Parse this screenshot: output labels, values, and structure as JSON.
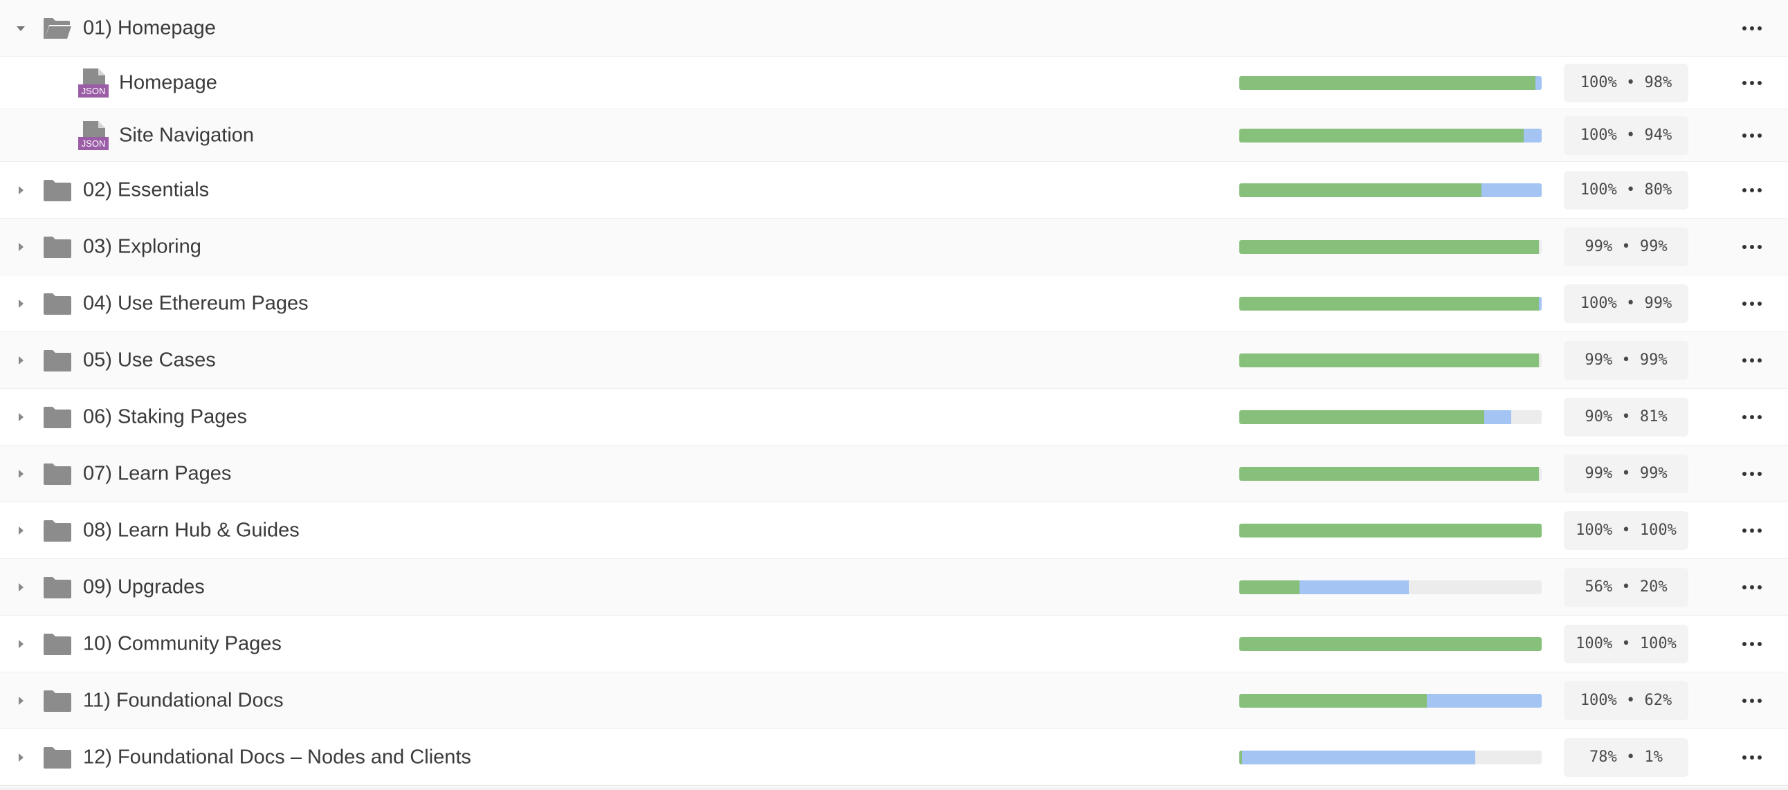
{
  "colors": {
    "translated": "#86c07a",
    "approved_pending": "#a4c4f4",
    "track": "#ececec",
    "icon_gray": "#8c8c8c",
    "json_badge": "#9b5ea6"
  },
  "icons": {
    "expanded": "chevron-down-icon",
    "collapsed": "chevron-right-icon",
    "folder_open": "folder-open-icon",
    "folder": "folder-icon",
    "file": "json-file-icon",
    "menu": "more-horizontal-icon"
  },
  "json_badge_label": "JSON",
  "rows": [
    {
      "kind": "folder",
      "expanded": true,
      "name": "01) Homepage",
      "progress": null
    },
    {
      "kind": "file",
      "name": "Homepage",
      "progress": {
        "translated": 98,
        "approved": 100
      },
      "badge": "100% • 98%"
    },
    {
      "kind": "file",
      "name": "Site Navigation",
      "progress": {
        "translated": 94,
        "approved": 100
      },
      "badge": "100% • 94%"
    },
    {
      "kind": "folder",
      "expanded": false,
      "name": "02) Essentials",
      "progress": {
        "translated": 80,
        "approved": 100
      },
      "badge": "100% • 80%"
    },
    {
      "kind": "folder",
      "expanded": false,
      "name": "03) Exploring",
      "progress": {
        "translated": 99,
        "approved": 99
      },
      "badge": "99% • 99%"
    },
    {
      "kind": "folder",
      "expanded": false,
      "name": "04) Use Ethereum Pages",
      "progress": {
        "translated": 99,
        "approved": 100
      },
      "badge": "100% • 99%"
    },
    {
      "kind": "folder",
      "expanded": false,
      "name": "05) Use Cases",
      "progress": {
        "translated": 99,
        "approved": 99
      },
      "badge": "99% • 99%"
    },
    {
      "kind": "folder",
      "expanded": false,
      "name": "06) Staking Pages",
      "progress": {
        "translated": 81,
        "approved": 90
      },
      "badge": "90% • 81%"
    },
    {
      "kind": "folder",
      "expanded": false,
      "name": "07) Learn Pages",
      "progress": {
        "translated": 99,
        "approved": 99
      },
      "badge": "99% • 99%"
    },
    {
      "kind": "folder",
      "expanded": false,
      "name": "08) Learn Hub & Guides",
      "progress": {
        "translated": 100,
        "approved": 100
      },
      "badge": "100% • 100%"
    },
    {
      "kind": "folder",
      "expanded": false,
      "name": "09) Upgrades",
      "progress": {
        "translated": 20,
        "approved": 56
      },
      "badge": "56% • 20%"
    },
    {
      "kind": "folder",
      "expanded": false,
      "name": "10) Community Pages",
      "progress": {
        "translated": 100,
        "approved": 100
      },
      "badge": "100% • 100%"
    },
    {
      "kind": "folder",
      "expanded": false,
      "name": "11) Foundational Docs",
      "progress": {
        "translated": 62,
        "approved": 100
      },
      "badge": "100% • 62%"
    },
    {
      "kind": "folder",
      "expanded": false,
      "name": "12) Foundational Docs – Nodes and Clients",
      "progress": {
        "translated": 1,
        "approved": 78
      },
      "badge": "78% • 1%"
    }
  ]
}
